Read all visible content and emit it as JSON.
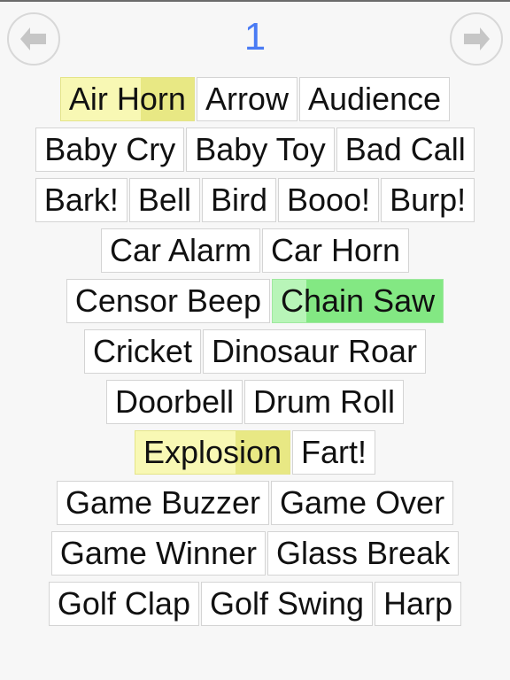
{
  "pager": {
    "prev_label": "previous page",
    "next_label": "next page",
    "page_number": "1",
    "page_number_color": "#4a7bf4",
    "arrow_color": "#c6c6c6",
    "ring_color": "#d8d8d8"
  },
  "colors": {
    "background": "#f7f7f7",
    "button_bg": "#ffffff",
    "button_border": "#d4d4d4",
    "text": "#111111",
    "yellow_light": "#f8f8b4",
    "yellow_dark": "#e8e884",
    "green_light": "#b8f5b8",
    "green_dark": "#83e883"
  },
  "grid": {
    "rows": [
      {
        "buttons": [
          {
            "label": "Air Horn",
            "state": "yellow",
            "progress": 60
          },
          {
            "label": "Arrow",
            "state": "idle",
            "progress": 0
          },
          {
            "label": "Audience",
            "state": "idle",
            "progress": 0
          }
        ]
      },
      {
        "buttons": [
          {
            "label": "Baby Cry",
            "state": "idle",
            "progress": 0
          },
          {
            "label": "Baby Toy",
            "state": "idle",
            "progress": 0
          },
          {
            "label": "Bad Call",
            "state": "idle",
            "progress": 0
          }
        ]
      },
      {
        "buttons": [
          {
            "label": "Bark!",
            "state": "idle",
            "progress": 0
          },
          {
            "label": "Bell",
            "state": "idle",
            "progress": 0
          },
          {
            "label": "Bird",
            "state": "idle",
            "progress": 0
          },
          {
            "label": "Booo!",
            "state": "idle",
            "progress": 0
          },
          {
            "label": "Burp!",
            "state": "idle",
            "progress": 0
          }
        ]
      },
      {
        "buttons": [
          {
            "label": "Car Alarm",
            "state": "idle",
            "progress": 0
          },
          {
            "label": "Car Horn",
            "state": "idle",
            "progress": 0
          }
        ]
      },
      {
        "buttons": [
          {
            "label": "Censor Beep",
            "state": "idle",
            "progress": 0
          },
          {
            "label": "Chain Saw",
            "state": "green",
            "progress": 20
          }
        ]
      },
      {
        "buttons": [
          {
            "label": "Cricket",
            "state": "idle",
            "progress": 0
          },
          {
            "label": "Dinosaur Roar",
            "state": "idle",
            "progress": 0
          }
        ]
      },
      {
        "buttons": [
          {
            "label": "Doorbell",
            "state": "idle",
            "progress": 0
          },
          {
            "label": "Drum Roll",
            "state": "idle",
            "progress": 0
          }
        ]
      },
      {
        "buttons": [
          {
            "label": "Explosion",
            "state": "yellow",
            "progress": 65
          },
          {
            "label": "Fart!",
            "state": "idle",
            "progress": 0
          }
        ]
      },
      {
        "buttons": [
          {
            "label": "Game Buzzer",
            "state": "idle",
            "progress": 0
          },
          {
            "label": "Game Over",
            "state": "idle",
            "progress": 0
          }
        ]
      },
      {
        "buttons": [
          {
            "label": "Game Winner",
            "state": "idle",
            "progress": 0
          },
          {
            "label": "Glass Break",
            "state": "idle",
            "progress": 0
          }
        ]
      },
      {
        "buttons": [
          {
            "label": "Golf Clap",
            "state": "idle",
            "progress": 0
          },
          {
            "label": "Golf Swing",
            "state": "idle",
            "progress": 0
          },
          {
            "label": "Harp",
            "state": "idle",
            "progress": 0
          }
        ]
      }
    ]
  }
}
